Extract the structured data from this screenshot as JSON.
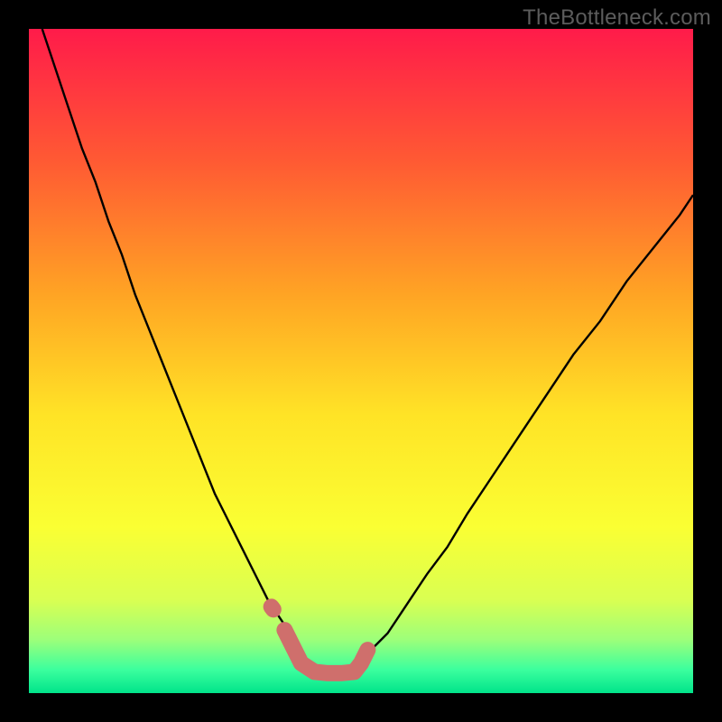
{
  "watermark": {
    "text": "TheBottleneck.com"
  },
  "chart_data": {
    "type": "line",
    "title": "",
    "xlabel": "",
    "ylabel": "",
    "xlim": [
      0,
      100
    ],
    "ylim": [
      0,
      100
    ],
    "grid": false,
    "legend": false,
    "gradient_stops": [
      {
        "offset": 0.0,
        "color": "#ff1b4a"
      },
      {
        "offset": 0.2,
        "color": "#ff5a33"
      },
      {
        "offset": 0.4,
        "color": "#ffa424"
      },
      {
        "offset": 0.58,
        "color": "#ffe326"
      },
      {
        "offset": 0.75,
        "color": "#faff33"
      },
      {
        "offset": 0.86,
        "color": "#d9ff52"
      },
      {
        "offset": 0.92,
        "color": "#9cff7a"
      },
      {
        "offset": 0.965,
        "color": "#3bff9e"
      },
      {
        "offset": 1.0,
        "color": "#00e38a"
      }
    ],
    "series": [
      {
        "name": "left-curve",
        "stroke": "#000000",
        "stroke_width": 2.4,
        "x": [
          2,
          4,
          6,
          8,
          10,
          12,
          14,
          16,
          18,
          20,
          22,
          24,
          26,
          28,
          30,
          32,
          34,
          36,
          38,
          40,
          41,
          42,
          43
        ],
        "y": [
          100,
          94,
          88,
          82,
          77,
          71,
          66,
          60,
          55,
          50,
          45,
          40,
          35,
          30,
          26,
          22,
          18,
          14,
          11,
          8,
          6,
          5,
          4
        ]
      },
      {
        "name": "right-curve",
        "stroke": "#000000",
        "stroke_width": 2.4,
        "x": [
          48,
          50,
          52,
          54,
          56,
          58,
          60,
          63,
          66,
          70,
          74,
          78,
          82,
          86,
          90,
          94,
          98,
          100
        ],
        "y": [
          4,
          5,
          7,
          9,
          12,
          15,
          18,
          22,
          27,
          33,
          39,
          45,
          51,
          56,
          62,
          67,
          72,
          75
        ]
      },
      {
        "name": "pink-marker-band",
        "stroke": "#cf6f6c",
        "stroke_width": 18,
        "linecap": "round",
        "x": [
          38.5,
          39.5,
          41,
          43,
          45,
          47,
          49,
          50,
          51
        ],
        "y": [
          9.5,
          7.5,
          4.5,
          3.2,
          3.0,
          3.0,
          3.2,
          4.5,
          6.5
        ]
      },
      {
        "name": "pink-dot-left",
        "stroke": "#cf6f6c",
        "stroke_width": 18,
        "linecap": "round",
        "x": [
          36.5,
          36.8
        ],
        "y": [
          13.0,
          12.6
        ]
      }
    ]
  }
}
